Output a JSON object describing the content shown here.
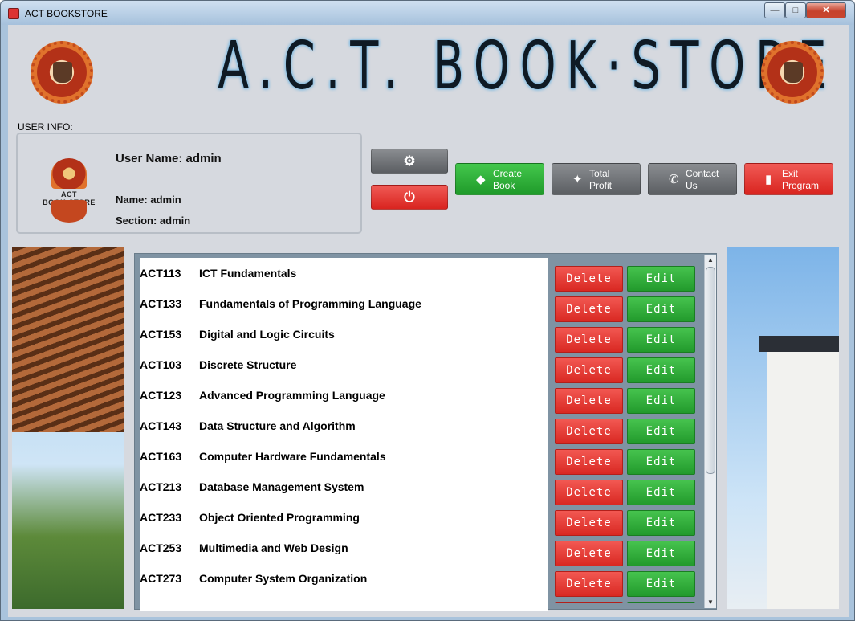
{
  "window": {
    "title": "ACT BOOKSTORE",
    "controls": {
      "minimize": "—",
      "maximize": "□",
      "close": "✕"
    }
  },
  "banner": {
    "title": "A.C.T. BOOK·STORE"
  },
  "user_info": {
    "label": "USER INFO:",
    "logo_text": "ACT BOOK·STORE",
    "user_name": "User Name:  admin",
    "name": "Name: admin",
    "section": "Section: admin"
  },
  "toolbar": {
    "settings_icon": "⚙",
    "power_icon": "⏻",
    "create_book": "Create\nBook",
    "total_profit": "Total\nProfit",
    "contact_us": "Contact\nUs",
    "exit_program": "Exit\nProgram",
    "icons": {
      "create": "tag-icon",
      "profit": "handshake-icon",
      "contact": "phone-icon",
      "exit": "exit-door-icon"
    }
  },
  "books": [
    {
      "code": "ACT113",
      "title": "ICT Fundamentals"
    },
    {
      "code": "ACT133",
      "title": "Fundamentals of Programming Language"
    },
    {
      "code": "ACT153",
      "title": "Digital and Logic Circuits"
    },
    {
      "code": "ACT103",
      "title": "Discrete Structure"
    },
    {
      "code": "ACT123",
      "title": "Advanced Programming Language"
    },
    {
      "code": "ACT143",
      "title": "Data Structure and Algorithm"
    },
    {
      "code": "ACT163",
      "title": "Computer Hardware Fundamentals"
    },
    {
      "code": "ACT213",
      "title": "Database Management System"
    },
    {
      "code": "ACT233",
      "title": "Object Oriented Programming"
    },
    {
      "code": "ACT253",
      "title": "Multimedia and Web Design"
    },
    {
      "code": "ACT273",
      "title": "Computer System Organization"
    }
  ],
  "row_actions": {
    "delete": "Delete",
    "edit": "Edit"
  },
  "colors": {
    "red": "#d9241f",
    "green": "#1f9a2a",
    "gray": "#5b5e62",
    "list_bg": "#7f93a3"
  }
}
